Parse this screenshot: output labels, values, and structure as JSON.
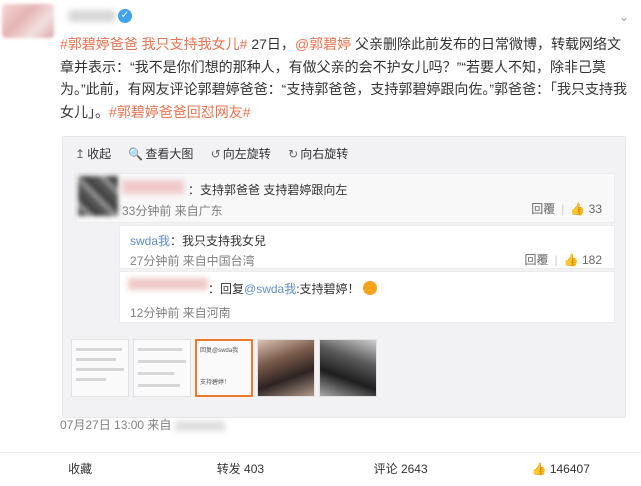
{
  "post": {
    "verified_mark": "✓",
    "menu_icon": "⌄",
    "topic1": "#郭碧婷爸爸 我只支持我女儿#",
    "date_ref": " 27日，",
    "mention": "@郭碧婷",
    "text1": " 父亲删除此前发布的日常微博，转载网络文章并表示：“我不是你们想的那种人，有做父亲的会不护女儿吗？”“若要人不知，除非己莫为。”此前，有网友评论郭碧婷爸爸：“支持郭爸爸，支持郭碧婷跟向佐。”郭爸爸：「我只支持我女儿」。",
    "topic2": "#郭碧婷爸爸回怼网友#"
  },
  "toolbar": {
    "collapse": "收起",
    "view_large": "查看大图",
    "rotate_left": "向左旋转",
    "rotate_right": "向右旋转"
  },
  "comments": [
    {
      "text": "：支持郭爸爸 支持碧婷跟向左",
      "meta": "33分钟前  来自广东",
      "reply_label": "回覆",
      "likes": "33"
    },
    {
      "user": "swda我",
      "text": "：我只支持我女兒",
      "meta": "27分钟前  来自中国台湾",
      "reply_label": "回覆",
      "likes": "182"
    },
    {
      "prefix": "：回复",
      "mention": "@swda我",
      "text": ":支持碧婷！",
      "meta": "12分钟前  来自河南"
    }
  ],
  "image_text": {
    "line1": "回复@swda我",
    "line2": "支持碧婷！"
  },
  "date": {
    "text": "07月27日 13:00",
    "from": " 来自"
  },
  "footer": {
    "favorite": "收藏",
    "repost": "转发 403",
    "comment": "评论 2643",
    "like": "146407"
  },
  "icons": {
    "like": "👍",
    "collapse": "↥",
    "view": "🔍",
    "rotate_left": "↺",
    "rotate_right": "↻"
  },
  "colors": {
    "link": "#eb7350",
    "mention_blue": "#5d8dc4",
    "selected_border": "#eb7a2f"
  }
}
